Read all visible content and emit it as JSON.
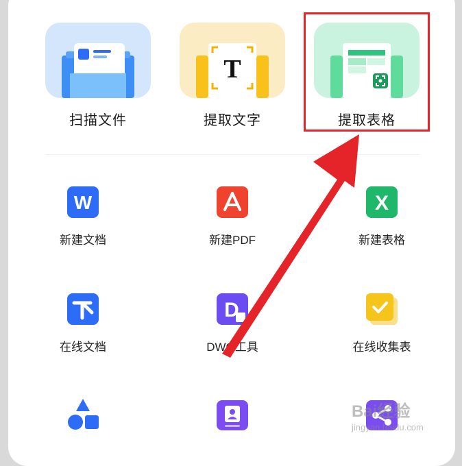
{
  "tools": [
    {
      "label": "扫描文件",
      "icon": "scan-document-icon",
      "color": "#d3e6fb"
    },
    {
      "label": "提取文字",
      "icon": "extract-text-icon",
      "color": "#fbecc4",
      "glyph": "T"
    },
    {
      "label": "提取表格",
      "icon": "extract-table-icon",
      "color": "#c9f3df"
    }
  ],
  "apps": [
    {
      "label": "新建文档",
      "icon": "word-doc-icon",
      "color": "#2d6cf6",
      "glyph": "W"
    },
    {
      "label": "新建PDF",
      "icon": "pdf-icon",
      "color": "#f0432f"
    },
    {
      "label": "新建表格",
      "icon": "excel-sheet-icon",
      "color": "#1fb86a",
      "glyph": "X"
    },
    {
      "label": "在线文档",
      "icon": "online-doc-icon",
      "color": "#2d6cf6"
    },
    {
      "label": "DWG工具",
      "icon": "dwg-tool-icon",
      "color": "#6a4cf2",
      "glyph": "D"
    },
    {
      "label": "在线收集表",
      "icon": "online-form-icon",
      "color": "#f6c51b"
    },
    {
      "label": "",
      "icon": "shapes-icon",
      "color": "#2d6cf6"
    },
    {
      "label": "",
      "icon": "contact-card-icon",
      "color": "#7a4cf2"
    },
    {
      "label": "",
      "icon": "flowchart-icon",
      "color": "#7a4cf2"
    }
  ],
  "annotation": {
    "color": "#e5242a"
  },
  "watermark": {
    "main": "Bai经验",
    "sub": "jingyan.baidu.com"
  }
}
